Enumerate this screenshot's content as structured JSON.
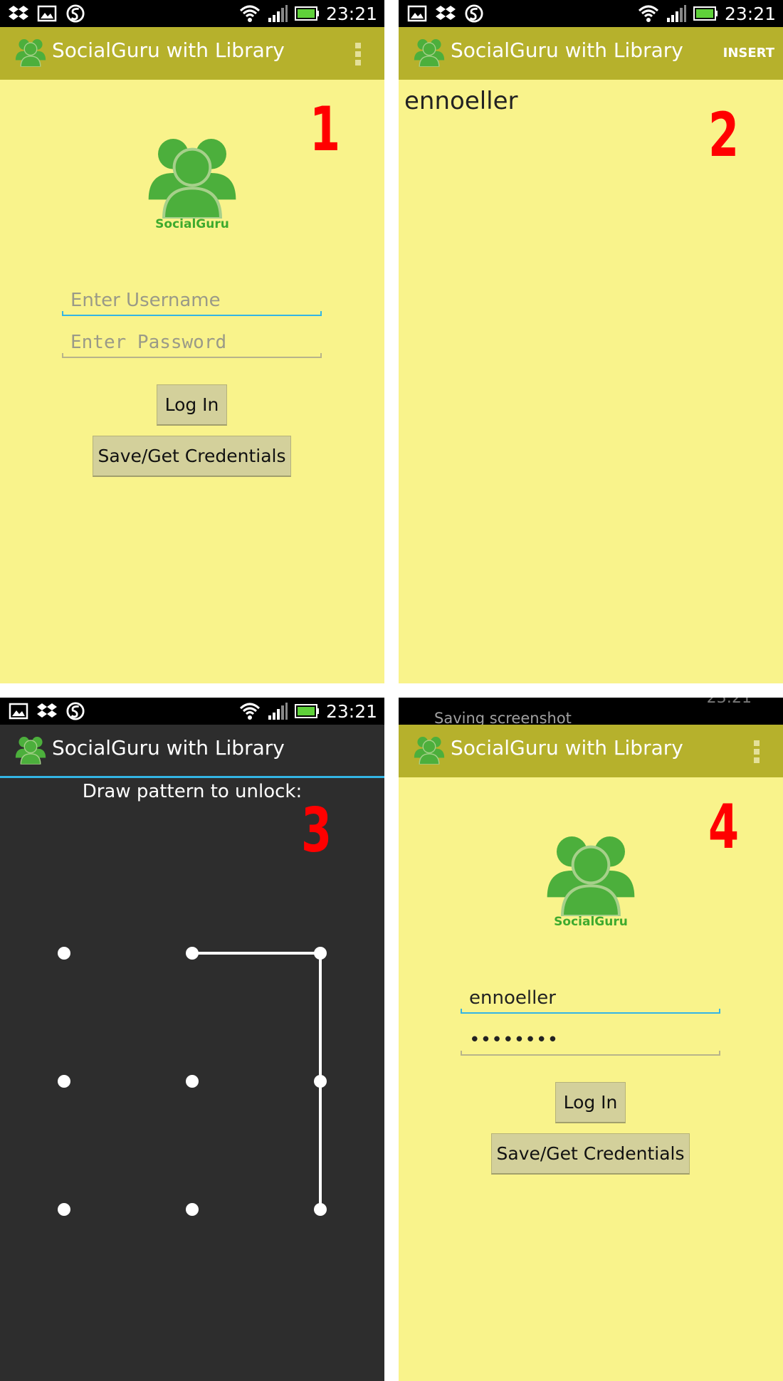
{
  "status_bar": {
    "time": "23:21",
    "saving_text": "Saving screenshot"
  },
  "app": {
    "title": "SocialGuru with Library",
    "logo_text": "SocialGuru"
  },
  "panel1": {
    "step": "1",
    "username_placeholder": "Enter Username",
    "password_placeholder": "Enter Password",
    "login_label": "Log In",
    "credentials_label": "Save/Get Credentials"
  },
  "panel2": {
    "step": "2",
    "action_label": "INSERT",
    "items": [
      "ennoeller"
    ]
  },
  "panel3": {
    "step": "3",
    "prompt": "Draw pattern to unlock:",
    "pattern_path": [
      1,
      2,
      5,
      8
    ]
  },
  "panel4": {
    "step": "4",
    "username_value": "ennoeller",
    "password_value": "********",
    "login_label": "Log In",
    "credentials_label": "Save/Get Credentials"
  },
  "colors": {
    "action_bar": "#b6b12c",
    "content_bg": "#f9f38b",
    "dark_bg": "#2d2d2d",
    "accent": "#33b5e5",
    "logo_green": "#4caf3c",
    "step_red": "#ff0000"
  },
  "icons": [
    "dropbox-icon",
    "gallery-icon",
    "swype-icon",
    "wifi-icon",
    "signal-icon",
    "battery-icon",
    "overflow-menu-icon",
    "app-logo-icon"
  ]
}
